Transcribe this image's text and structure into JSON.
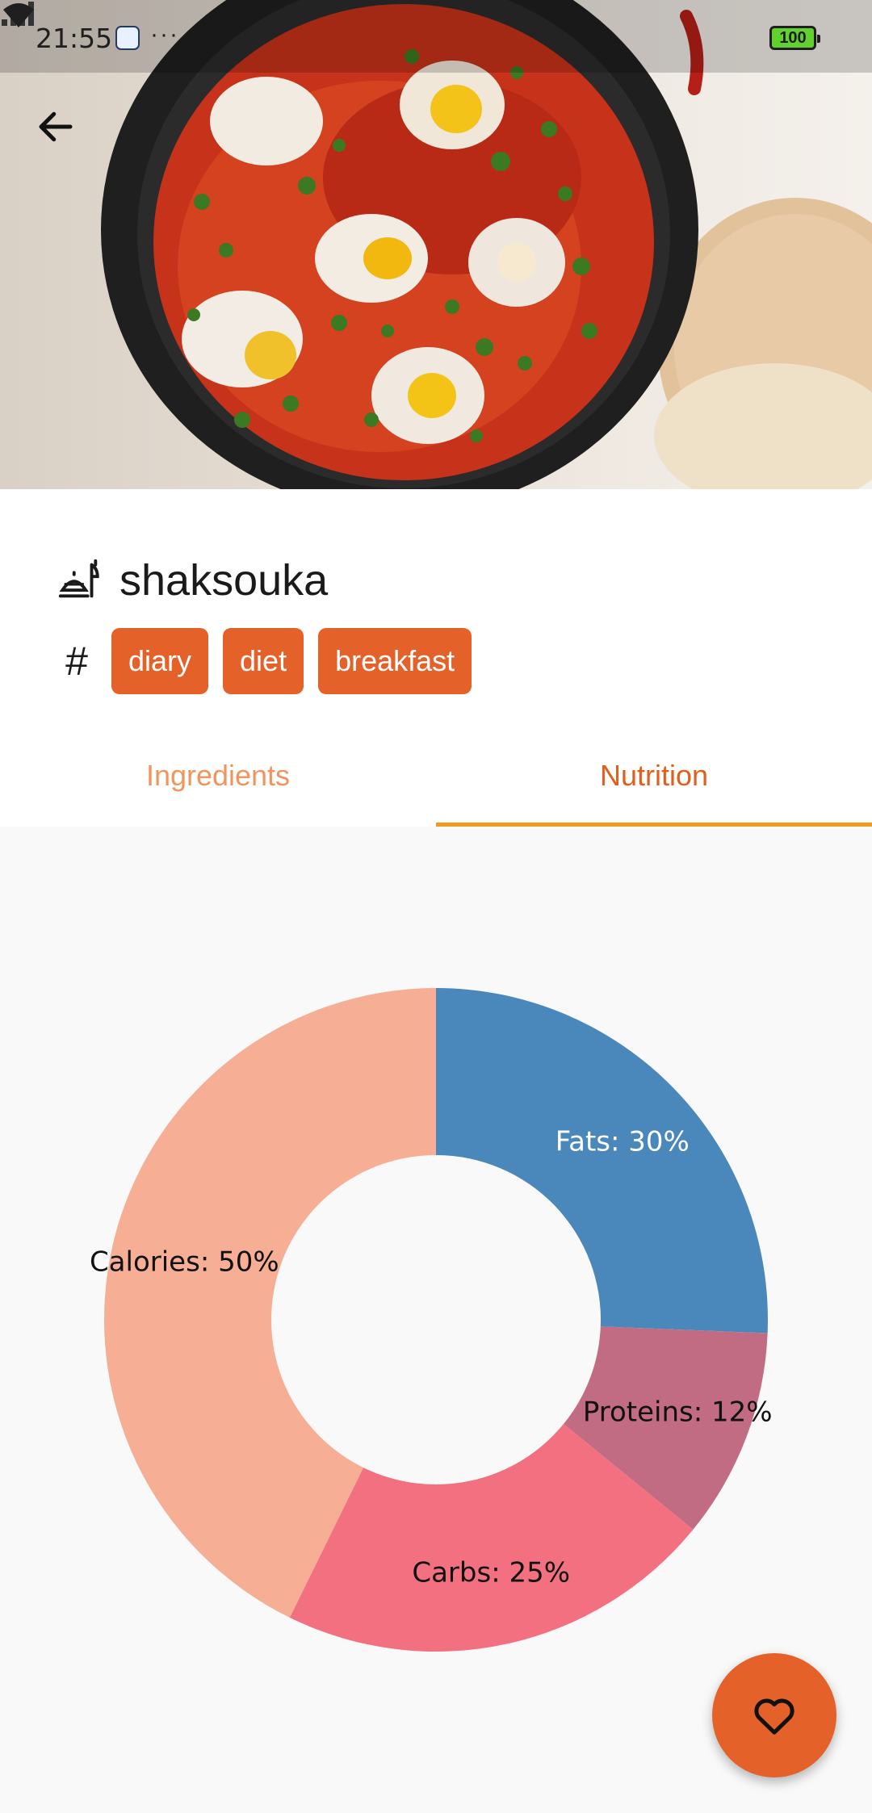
{
  "status_bar": {
    "time": "21:55",
    "battery": "100"
  },
  "recipe": {
    "title": "shaksouka",
    "tags": [
      "diary",
      "diet",
      "breakfast"
    ]
  },
  "tabs": [
    {
      "label": "Ingredients",
      "active": false
    },
    {
      "label": "Nutrition",
      "active": true
    }
  ],
  "colors": {
    "accent": "#e5612a",
    "tab_indicator": "#ef9a1c",
    "fats": "#4a88bb",
    "proteins": "#c26c84",
    "carbs": "#f2707f",
    "calories": "#f6ae94"
  },
  "icons": {
    "back": "arrow-left-icon",
    "title": "food-tray-icon",
    "tags": "hash-icon",
    "favorite": "heart-outline-icon"
  },
  "chart_data": {
    "type": "pie",
    "donut": true,
    "slices": [
      {
        "label": "Fats",
        "value": 30,
        "display": "Fats: 30%",
        "color": "#4a88bb"
      },
      {
        "label": "Proteins",
        "value": 12,
        "display": "Proteins: 12%",
        "color": "#c26c84"
      },
      {
        "label": "Carbs",
        "value": 25,
        "display": "Carbs: 25%",
        "color": "#f2707f"
      },
      {
        "label": "Calories",
        "value": 50,
        "display": "Calories: 50%",
        "color": "#f6ae94"
      }
    ]
  }
}
